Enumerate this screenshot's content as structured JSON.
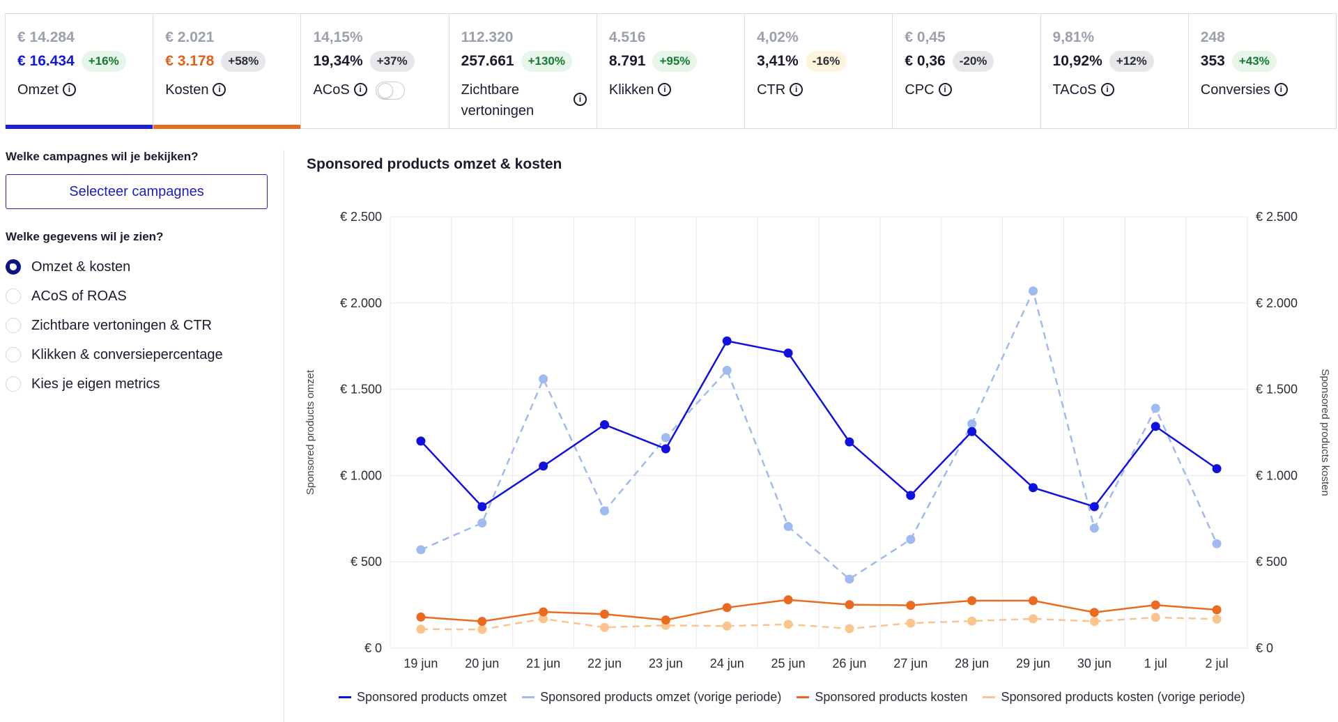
{
  "kpis": [
    {
      "prev": "€ 14.284",
      "cur": "€ 16.434",
      "cur_color": "#1018d9",
      "badge": "+16%",
      "badge_style": "green",
      "label": "Omzet",
      "bar": "#1f1fd6"
    },
    {
      "prev": "€ 2.021",
      "cur": "€ 3.178",
      "cur_color": "#e0621a",
      "badge": "+58%",
      "badge_style": "grey",
      "label": "Kosten",
      "bar": "#e86d24"
    },
    {
      "prev": "14,15%",
      "cur": "19,34%",
      "cur_color": "#1b1b2f",
      "badge": "+37%",
      "badge_style": "grey",
      "label": "ACoS",
      "toggle": true
    },
    {
      "prev": "112.320",
      "cur": "257.661",
      "cur_color": "#1b1b2f",
      "badge": "+130%",
      "badge_style": "green",
      "label": "Zichtbare vertoningen"
    },
    {
      "prev": "4.516",
      "cur": "8.791",
      "cur_color": "#1b1b2f",
      "badge": "+95%",
      "badge_style": "green",
      "label": "Klikken"
    },
    {
      "prev": "4,02%",
      "cur": "3,41%",
      "cur_color": "#1b1b2f",
      "badge": "-16%",
      "badge_style": "yellow",
      "label": "CTR"
    },
    {
      "prev": "€ 0,45",
      "cur": "€ 0,36",
      "cur_color": "#1b1b2f",
      "badge": "-20%",
      "badge_style": "grey",
      "label": "CPC"
    },
    {
      "prev": "9,81%",
      "cur": "10,92%",
      "cur_color": "#1b1b2f",
      "badge": "+12%",
      "badge_style": "grey",
      "label": "TACoS"
    },
    {
      "prev": "248",
      "cur": "353",
      "cur_color": "#1b1b2f",
      "badge": "+43%",
      "badge_style": "green",
      "label": "Conversies"
    }
  ],
  "left": {
    "campaign_question": "Welke campagnes wil je bekijken?",
    "select_button": "Selecteer campagnes",
    "data_question": "Welke gegevens wil je zien?",
    "options": [
      "Omzet & kosten",
      "ACoS of ROAS",
      "Zichtbare vertoningen & CTR",
      "Klikken & conversiepercentage",
      "Kies je eigen metrics"
    ],
    "selected_index": 0
  },
  "chart_title": "Sponsored products omzet & kosten",
  "colors": {
    "omzet": "#1010e0",
    "omzet_prev": "#9fbaf0",
    "kosten": "#ea6a1f",
    "kosten_prev": "#fbc48c"
  },
  "chart_data": {
    "type": "line",
    "x": [
      "19 jun",
      "20 jun",
      "21 jun",
      "22 jun",
      "23 jun",
      "24 jun",
      "25 jun",
      "26 jun",
      "27 jun",
      "28 jun",
      "29 jun",
      "30 jun",
      "1 jul",
      "2 jul"
    ],
    "ylim": [
      0,
      2500
    ],
    "yticks": [
      "€ 0",
      "€ 500",
      "€ 1.000",
      "€ 1.500",
      "€ 2.000",
      "€ 2.500"
    ],
    "ylabel_left": "Sponsored products omzet",
    "ylabel_right": "Sponsored products kosten",
    "grid": true,
    "legend_position": "bottom",
    "series": [
      {
        "name": "Sponsored products omzet",
        "key": "omzet",
        "dashed": false,
        "values": [
          1200,
          820,
          1055,
          1295,
          1155,
          1780,
          1710,
          1195,
          885,
          1255,
          930,
          820,
          1285,
          1040
        ]
      },
      {
        "name": "Sponsored products omzet (vorige periode)",
        "key": "omzet_prev",
        "dashed": true,
        "values": [
          570,
          725,
          1560,
          795,
          1220,
          1610,
          705,
          400,
          630,
          1300,
          2070,
          695,
          1390,
          605
        ]
      },
      {
        "name": "Sponsored products kosten",
        "key": "kosten",
        "dashed": false,
        "values": [
          180,
          155,
          210,
          197,
          163,
          235,
          280,
          252,
          248,
          275,
          275,
          207,
          250,
          222
        ]
      },
      {
        "name": "Sponsored products kosten (vorige periode)",
        "key": "kosten_prev",
        "dashed": true,
        "values": [
          110,
          108,
          170,
          120,
          132,
          128,
          138,
          113,
          145,
          157,
          170,
          155,
          178,
          168
        ]
      }
    ]
  }
}
